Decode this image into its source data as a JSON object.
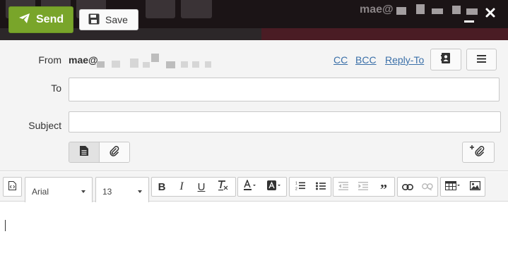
{
  "background": {
    "account_email": "mae@"
  },
  "toolbar": {
    "send_label": "Send",
    "save_label": "Save"
  },
  "compose": {
    "from_label": "From",
    "from_email": "mae@",
    "to_label": "To",
    "to_value": "",
    "subject_label": "Subject",
    "subject_value": "",
    "links": {
      "cc": "CC",
      "bcc": "BCC",
      "reply_to": "Reply-To"
    }
  },
  "editor": {
    "font_family": "Arial",
    "font_size": "13",
    "body_text": ""
  },
  "icons": {
    "send": "paper-plane-icon",
    "save": "floppy-disk-icon",
    "minimize": "minimize-icon",
    "close": "close-icon",
    "contacts": "address-book-icon",
    "menu": "hamburger-menu-icon",
    "plain_text": "document-icon",
    "attachment": "paperclip-icon",
    "add_attachment": "add-attachment-icon",
    "source": "source-code-icon",
    "bold": "bold-icon",
    "italic": "italic-icon",
    "underline": "underline-icon",
    "clear_format": "clear-format-icon",
    "text_color": "text-color-icon",
    "bg_color": "background-color-icon",
    "ordered_list": "ordered-list-icon",
    "unordered_list": "unordered-list-icon",
    "outdent": "outdent-icon",
    "indent": "indent-icon",
    "blockquote": "blockquote-icon",
    "link": "link-icon",
    "unlink": "unlink-icon",
    "table": "table-icon",
    "image": "image-icon"
  },
  "colors": {
    "send_button": "#79a52a",
    "link": "#3a6fa8",
    "panel_bg": "#f4f4f4",
    "background_header": "#1b1416"
  }
}
